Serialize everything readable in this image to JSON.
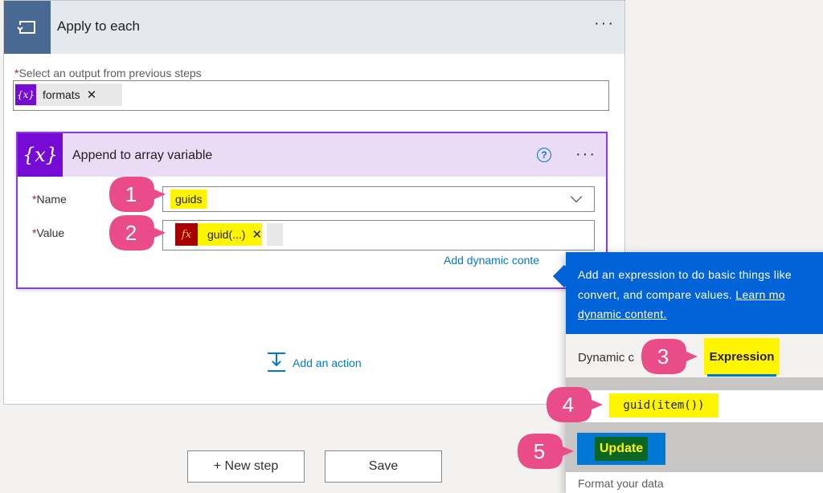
{
  "apply": {
    "title": "Apply to each",
    "more": "···",
    "select_label": "Select an output from previous steps",
    "required_mark": "*",
    "token_icon": "{x}",
    "token_label": "formats",
    "token_remove": "✕"
  },
  "append": {
    "title": "Append to array variable",
    "icon": "{x}",
    "help": "?",
    "more": "···",
    "name_label": "Name",
    "name_value": "guids",
    "value_label": "Value",
    "value_icon": "fx",
    "value_token": "guid(...)",
    "value_remove": "✕",
    "add_dynamic": "Add dynamic conte"
  },
  "add_action": "Add an action",
  "buttons": {
    "new_step": "+ New step",
    "save": "Save"
  },
  "panel": {
    "line1": "Add an expression to do basic things like",
    "line2_pre": "convert, and compare values. ",
    "line2_link": "Learn mo",
    "line3_link": "dynamic content.",
    "tab_dynamic": "Dynamic c",
    "tab_expression": "Expression",
    "expression": "guid(item())",
    "update": "Update",
    "format": "Format your data"
  },
  "callouts": [
    "1",
    "2",
    "3",
    "4",
    "5"
  ],
  "colors": {
    "callout": "#ea4c89",
    "highlight": "#fff500",
    "brand_blue": "#0078d4",
    "variable_purple": "#770bd6"
  }
}
